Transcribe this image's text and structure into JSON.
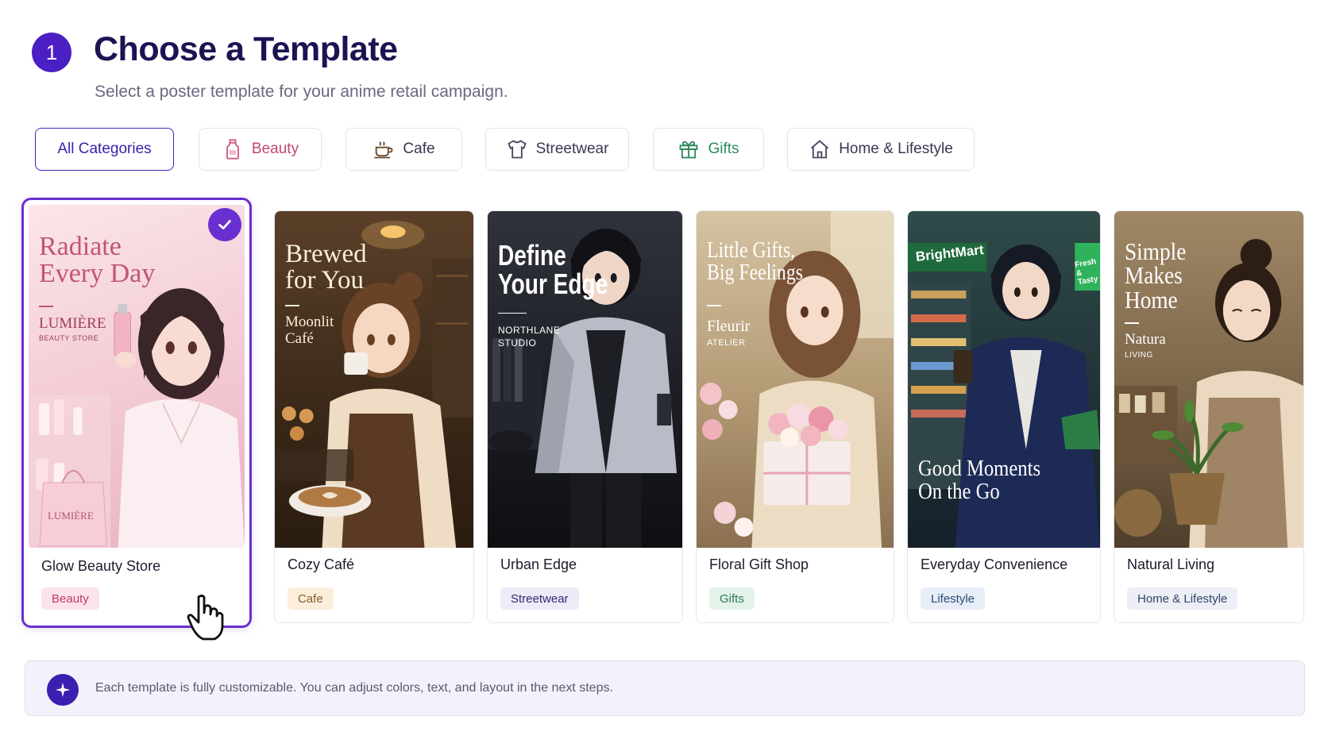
{
  "header": {
    "step_number": "1",
    "title": "Choose a Template",
    "subtitle": "Select a poster template for your anime retail campaign."
  },
  "categories": [
    {
      "label": "All Categories",
      "icon": null,
      "active": true
    },
    {
      "label": "Beauty",
      "icon": "bottle-icon",
      "color": "#c4476f"
    },
    {
      "label": "Cafe",
      "icon": "coffee-cup-icon"
    },
    {
      "label": "Streetwear",
      "icon": "tshirt-icon"
    },
    {
      "label": "Gifts",
      "icon": "gift-icon",
      "color": "#2f8a5e"
    },
    {
      "label": "Home & Lifestyle",
      "icon": "home-icon"
    }
  ],
  "templates": [
    {
      "name": "Glow Beauty Store",
      "tag": "Beauty",
      "selected": true,
      "poster": {
        "headline": [
          "Radiate",
          "Every Day"
        ],
        "brand": [
          "LUMIÈRE"
        ],
        "brand_sub": "BEAUTY STORE",
        "bag_text": "LUMIÈRE"
      },
      "colors": {
        "bg_top": "#f7d9e0",
        "bg_bottom": "#ecc0cb",
        "text": "#c1566f",
        "tag_bg": "#fbe3ea",
        "tag_fg": "#c23a63"
      }
    },
    {
      "name": "Cozy Café",
      "tag": "Cafe",
      "poster": {
        "headline": [
          "Brewed",
          "for You"
        ],
        "brand": [
          "Moonlit",
          "Café"
        ],
        "brand_sub": ""
      },
      "colors": {
        "bg_top": "#4a3420",
        "bg_bottom": "#2e1f13",
        "text": "#fbeed8",
        "tag_bg": "#fbefdc",
        "tag_fg": "#8a5a24"
      }
    },
    {
      "name": "Urban Edge",
      "tag": "Streetwear",
      "poster": {
        "headline": [
          "Define",
          "Your Edge"
        ],
        "brand": [],
        "brand_sub": "NORTHLANE\nSTUDIO"
      },
      "colors": {
        "bg_top": "#2a2d35",
        "bg_bottom": "#121317",
        "text": "#ffffff",
        "tag_bg": "#ecebf7",
        "tag_fg": "#2e2a6e"
      }
    },
    {
      "name": "Floral Gift Shop",
      "tag": "Gifts",
      "poster": {
        "headline": [
          "Little Gifts,",
          "Big Feelings"
        ],
        "brand": [
          "Fleurir"
        ],
        "brand_sub": "ATELIER"
      },
      "colors": {
        "bg_top": "#c9b08a",
        "bg_bottom": "#8f7452",
        "text": "#ffffff",
        "tag_bg": "#e3f3ea",
        "tag_fg": "#2f7a55"
      }
    },
    {
      "name": "Everyday Convenience",
      "tag": "Lifestyle",
      "poster": {
        "headline": [
          "Good Moments",
          "On the Go"
        ],
        "brand": [],
        "brand_sub": "",
        "store_sign": "BrightMart",
        "sign_right": "Fresh & Tasty"
      },
      "colors": {
        "bg_top": "#2e4a48",
        "bg_bottom": "#1a2a30",
        "text": "#ffffff",
        "tag_bg": "#e7eef8",
        "tag_fg": "#2b4b78"
      }
    },
    {
      "name": "Natural Living",
      "tag": "Home & Lifestyle",
      "poster": {
        "headline": [
          "Simple",
          "Makes",
          "Home"
        ],
        "brand": [
          "Natura"
        ],
        "brand_sub": "LIVING"
      },
      "colors": {
        "bg_top": "#8c7656",
        "bg_bottom": "#5a4934",
        "text": "#ffffff",
        "tag_bg": "#eceff6",
        "tag_fg": "#334468"
      }
    }
  ],
  "info": {
    "text": "Each template is fully customizable. You can adjust colors, text, and layout in the next steps.",
    "icon": "sparkle-icon"
  },
  "accent": "#4c1fc4"
}
